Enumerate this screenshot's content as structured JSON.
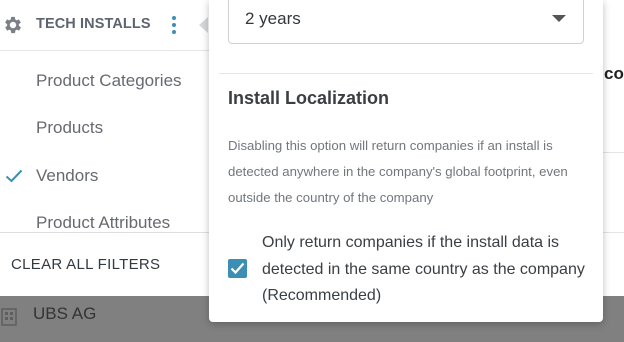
{
  "filter_panel": {
    "title": "TECH INSTALLS",
    "title_icon": "gear-icon",
    "menu_icon": "kebab-menu-icon",
    "items": [
      {
        "label": "Product Categories",
        "checked": false
      },
      {
        "label": "Products",
        "checked": false
      },
      {
        "label": "Vendors",
        "checked": true
      },
      {
        "label": "Product Attributes",
        "checked": false
      }
    ],
    "clear_all": "CLEAR ALL FILTERS"
  },
  "background": {
    "column_header_partial": "co",
    "row_company": "UBS AG",
    "row_icon": "building-icon"
  },
  "popover": {
    "time_range_select": {
      "value": "2 years"
    },
    "install_localization": {
      "title": "Install Localization",
      "description": "Disabling this option will return companies if an install is detected anywhere in the company's global footprint, even outside the country of the company",
      "checkbox_label": "Only return companies if the install data is detected in the same country as the company (Recommended)",
      "checked": true
    }
  },
  "colors": {
    "accent": "#3b8fb5",
    "checkmark": "#3d8fb4",
    "text_muted": "#666a70"
  }
}
